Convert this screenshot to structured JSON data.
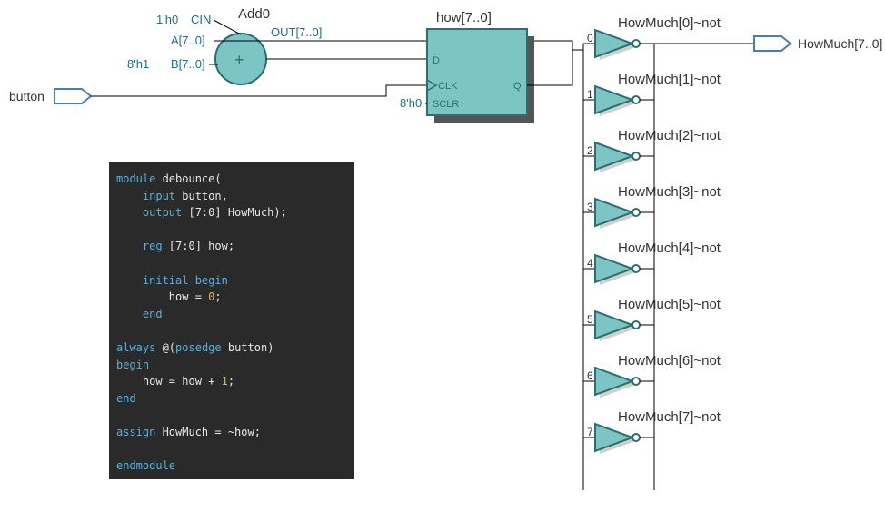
{
  "ports": {
    "input_button": "button",
    "output_bus": "HowMuch[7..0]"
  },
  "adder": {
    "title": "Add0",
    "cin": "1'h0",
    "cin_pin": "CIN",
    "a_pin": "A[7..0]",
    "b_const": "8'h1",
    "b_pin": "B[7..0]",
    "out_pin": "OUT[7..0]",
    "sym": "+"
  },
  "register": {
    "title": "how[7..0]",
    "d_pin": "D",
    "clk_pin": "CLK",
    "q_pin": "Q",
    "sclr_pin": "SCLR",
    "sclr_const": "8'h0"
  },
  "inverters": [
    {
      "label": "HowMuch[0]~not",
      "index": "0"
    },
    {
      "label": "HowMuch[1]~not",
      "index": "1"
    },
    {
      "label": "HowMuch[2]~not",
      "index": "2"
    },
    {
      "label": "HowMuch[3]~not",
      "index": "3"
    },
    {
      "label": "HowMuch[4]~not",
      "index": "4"
    },
    {
      "label": "HowMuch[5]~not",
      "index": "5"
    },
    {
      "label": "HowMuch[6]~not",
      "index": "6"
    },
    {
      "label": "HowMuch[7]~not",
      "index": "7"
    }
  ],
  "code": {
    "l1a": "module",
    "l1b": " debounce(",
    "l2a": "    input",
    "l2b": " button,",
    "l3a": "    output",
    "l3b": " [7:0] HowMuch);",
    "l4": " ",
    "l5a": "    reg",
    "l5b": " [7:0] how;",
    "l6": " ",
    "l7a": "    initial",
    "l7b": " begin",
    "l8a": "        how = ",
    "l8b": "0",
    "l8c": ";",
    "l9": "    end",
    "l10": " ",
    "l11a": "always",
    "l11b": " @(",
    "l11c": "posedge",
    "l11d": " button)",
    "l12": "begin",
    "l13a": "    how = how + ",
    "l13b": "1",
    "l13c": ";",
    "l14": "end",
    "l15": " ",
    "l16a": "assign",
    "l16b": " HowMuch = ~how;",
    "l17": " ",
    "l18": "endmodule"
  }
}
